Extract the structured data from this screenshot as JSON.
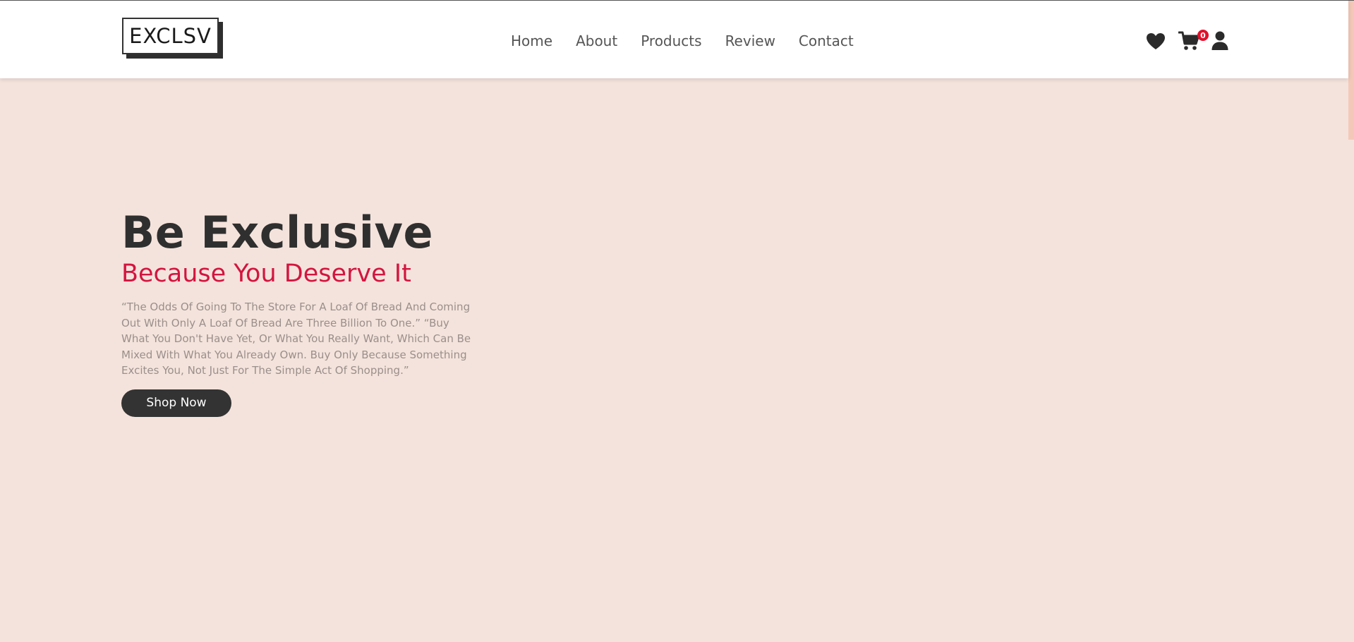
{
  "header": {
    "logo_text": "EXCLSV",
    "nav": [
      {
        "label": "Home"
      },
      {
        "label": "About"
      },
      {
        "label": "Products"
      },
      {
        "label": "Review"
      },
      {
        "label": "Contact"
      }
    ],
    "icons": {
      "wishlist": "heart-icon",
      "cart": "cart-icon",
      "account": "user-icon"
    },
    "cart_count": "0"
  },
  "hero": {
    "title": "Be Exclusive",
    "subtitle": "Because You Deserve It",
    "quote": "“The Odds Of Going To The Store For A Loaf Of Bread And Coming Out With Only A Loaf Of Bread Are Three Billion To One.” “Buy What You Don't Have Yet, Or What You Really Want, Which Can Be Mixed With What You Already Own. Buy Only Because Something Excites You, Not Just For The Simple Act Of Shopping.”",
    "cta_label": "Shop Now"
  },
  "colors": {
    "background": "#f4e3dc",
    "accent": "#d3153f",
    "dark": "#333333",
    "badge": "#e0102a"
  }
}
